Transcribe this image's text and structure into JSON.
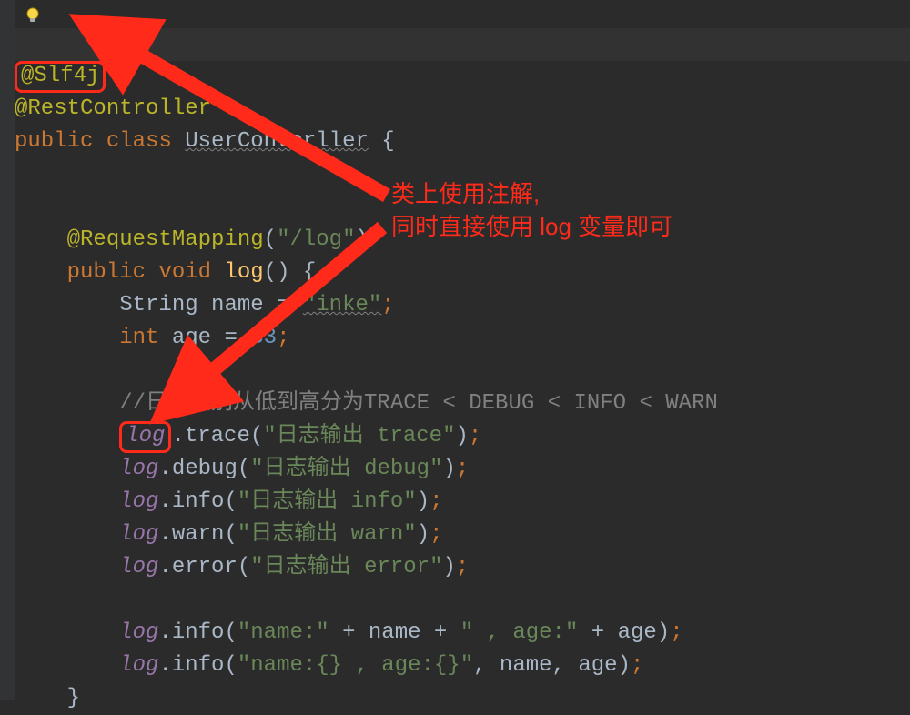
{
  "annotations": {
    "line1": "类上使用注解,",
    "line2": "同时直接使用 log 变量即可"
  },
  "code": {
    "slf4j": "@Slf4j",
    "restController": "@RestController",
    "public": "public",
    "class": "class",
    "className": "UserContorller",
    "openBrace": " {",
    "requestMapping": "@RequestMapping",
    "mappingPath": "\"/log\"",
    "voidKw": "void",
    "methodName": "log",
    "stringType": "String",
    "nameVar": "name",
    "eq": " = ",
    "nameVal": "\"inke\"",
    "intType": "int",
    "ageVar": "age",
    "ageVal": "33",
    "comment": "//日志级别从低到高分为TRACE < DEBUG < INFO < WARN",
    "logVar": "log",
    "traceCall": ".trace(",
    "traceStr": "\"日志输出 trace\"",
    "debugCall": ".debug(",
    "debugStr": "\"日志输出 debug\"",
    "infoCall": ".info(",
    "infoStr": "\"日志输出 info\"",
    "warnCall": ".warn(",
    "warnStr": "\"日志输出 warn\"",
    "errorCall": ".error(",
    "errorStr": "\"日志输出 error\"",
    "nameLabel": "\"name:\"",
    "plus": " + ",
    "ageLabel": "\" , age:\"",
    "fmtStr": "\"name:{} , age:{}\"",
    "comma": ", ",
    "closeParen": ")",
    "semi": ";",
    "closeBrace": "}"
  }
}
